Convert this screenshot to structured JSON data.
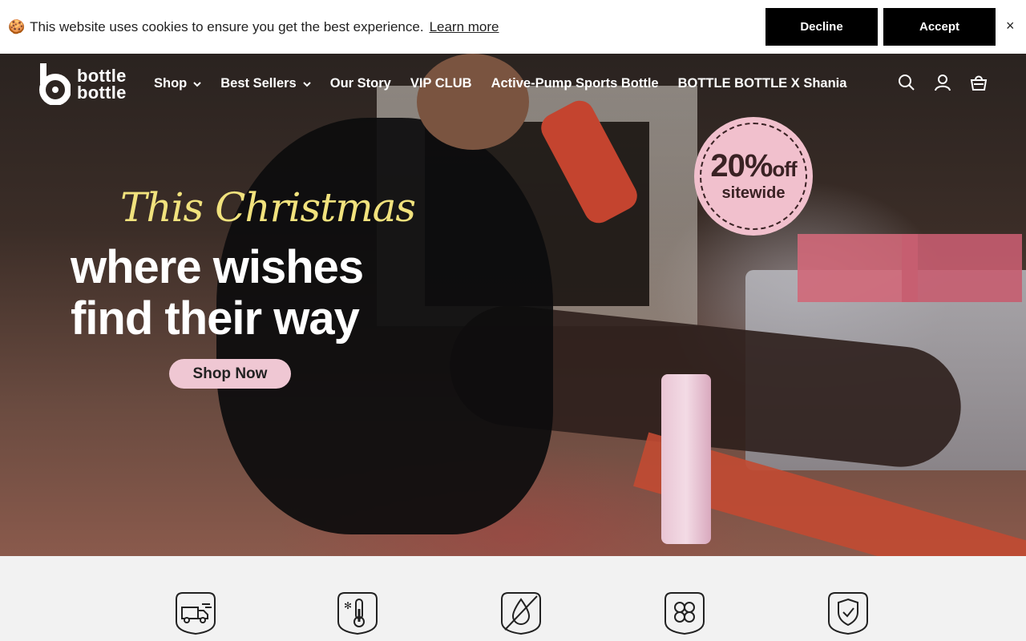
{
  "cookie": {
    "emoji": "🍪",
    "message": "This website uses cookies to ensure you get the best experience.",
    "learn_more": "Learn more",
    "decline": "Decline",
    "accept": "Accept",
    "close": "×"
  },
  "nav": {
    "logo_line1": "bottle",
    "logo_line2": "bottle",
    "items": [
      {
        "label": "Shop",
        "dropdown": true
      },
      {
        "label": "Best Sellers",
        "dropdown": true
      },
      {
        "label": "Our Story",
        "dropdown": false
      },
      {
        "label": "VIP CLUB",
        "dropdown": false
      },
      {
        "label": "Active-Pump Sports Bottle",
        "dropdown": false
      },
      {
        "label": "BOTTLE BOTTLE X Shania",
        "dropdown": false
      }
    ],
    "icons": [
      "search-icon",
      "account-icon",
      "cart-icon"
    ]
  },
  "hero": {
    "script_title": "This Christmas",
    "headline_line1": "where wishes",
    "headline_line2": "find their way",
    "cta": "Shop Now",
    "badge_percent": "20%",
    "badge_off": "off",
    "badge_sub": "sitewide"
  },
  "features": {
    "icons": [
      "delivery-truck-icon",
      "temperature-icon",
      "leakproof-icon",
      "clover-icon",
      "shield-check-icon"
    ]
  },
  "colors": {
    "cookie_button": "#000000",
    "badge_pink": "#f1c0cd",
    "script_yellow": "#f1e27d",
    "cta_pink": "#efc7d3"
  }
}
